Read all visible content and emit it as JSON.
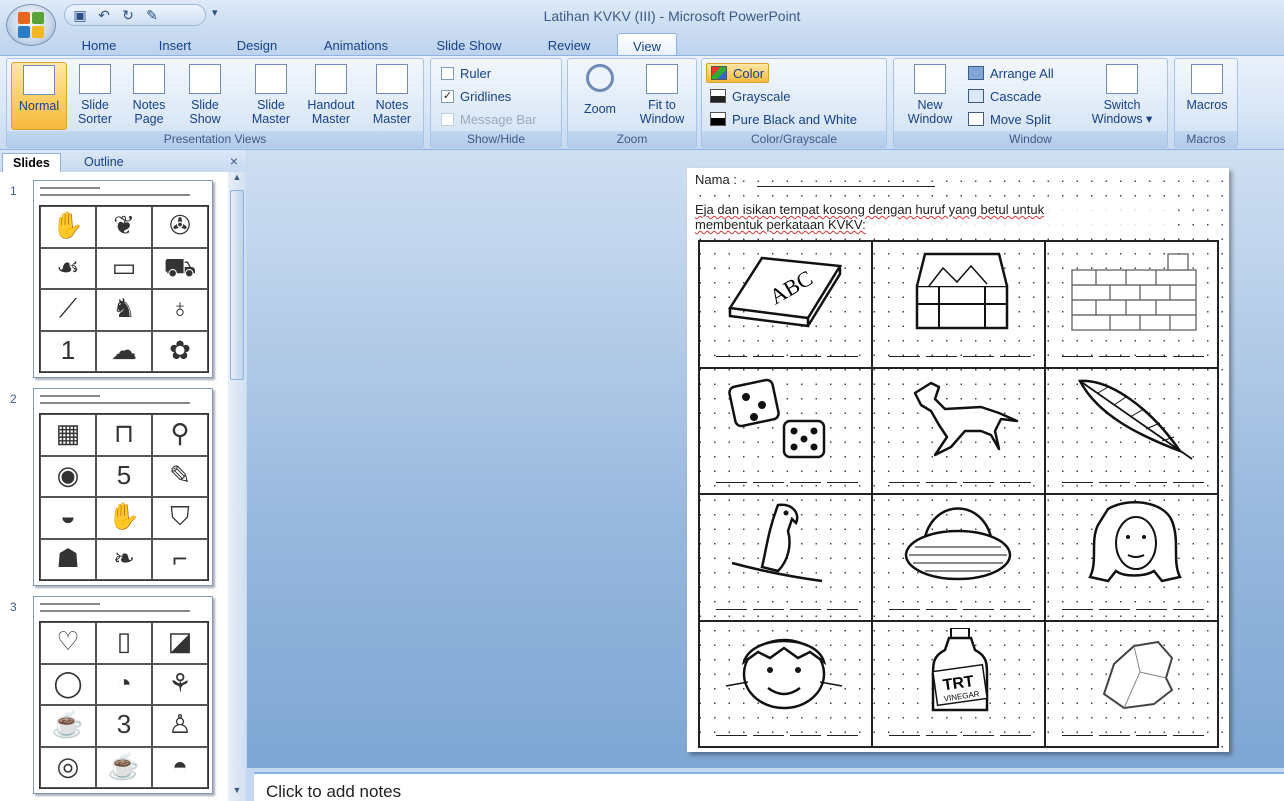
{
  "window": {
    "title": "Latihan KVKV (III) - Microsoft PowerPoint"
  },
  "qat": {
    "icons": [
      "save-icon",
      "undo-icon",
      "redo-icon",
      "repeat-icon"
    ],
    "more": "▾"
  },
  "tabs": [
    {
      "label": "Home"
    },
    {
      "label": "Insert"
    },
    {
      "label": "Design"
    },
    {
      "label": "Animations"
    },
    {
      "label": "Slide Show"
    },
    {
      "label": "Review"
    },
    {
      "label": "View"
    }
  ],
  "active_tab": "View",
  "ribbon": {
    "presentation_views": {
      "label": "Presentation Views",
      "buttons": [
        {
          "l1": "Normal",
          "l2": ""
        },
        {
          "l1": "Slide",
          "l2": "Sorter"
        },
        {
          "l1": "Notes",
          "l2": "Page"
        },
        {
          "l1": "Slide",
          "l2": "Show"
        },
        {
          "l1": "Slide",
          "l2": "Master"
        },
        {
          "l1": "Handout",
          "l2": "Master"
        },
        {
          "l1": "Notes",
          "l2": "Master"
        }
      ]
    },
    "show_hide": {
      "label": "Show/Hide",
      "items": [
        {
          "label": "Ruler",
          "checked": false
        },
        {
          "label": "Gridlines",
          "checked": true
        },
        {
          "label": "Message Bar",
          "checked": false
        }
      ]
    },
    "zoom": {
      "label": "Zoom",
      "zoom_btn": "Zoom",
      "fit_l1": "Fit to",
      "fit_l2": "Window"
    },
    "color_grayscale": {
      "label": "Color/Grayscale",
      "items": [
        {
          "label": "Color"
        },
        {
          "label": "Grayscale"
        },
        {
          "label": "Pure Black and White"
        }
      ]
    },
    "window": {
      "label": "Window",
      "new_l1": "New",
      "new_l2": "Window",
      "arrange_all": "Arrange All",
      "cascade": "Cascade",
      "move_split": "Move Split",
      "switch_l1": "Switch",
      "switch_l2": "Windows ▾"
    },
    "macros": {
      "label": "Macros",
      "button": "Macros"
    }
  },
  "left_pane": {
    "tabs": [
      {
        "label": "Slides"
      },
      {
        "label": "Outline"
      }
    ],
    "close": "×",
    "slides": [
      {
        "num": "1",
        "cells": [
          "",
          "",
          "",
          "",
          "",
          "",
          "",
          "",
          "",
          "1",
          "",
          ""
        ]
      },
      {
        "num": "2",
        "cells": [
          "",
          "",
          "",
          "",
          "5",
          "",
          "",
          "",
          "",
          "",
          "",
          ""
        ]
      },
      {
        "num": "3",
        "cells": [
          "",
          "",
          "",
          "",
          "",
          "",
          "",
          "3",
          "",
          "",
          "",
          ""
        ]
      }
    ]
  },
  "slide": {
    "nama_label": "Nama :",
    "instruction_part1": "Eja dan isikan tempat kosong dengan huruf yang betul untuk",
    "instruction_part2": "membentuk perkataan KVKV:",
    "cells": [
      {
        "picture": "buku"
      },
      {
        "picture": "peti"
      },
      {
        "picture": "batu-bata"
      },
      {
        "picture": "dadu"
      },
      {
        "picture": "kuda"
      },
      {
        "picture": "bulu"
      },
      {
        "picture": "burung-nuri"
      },
      {
        "picture": "bakul"
      },
      {
        "picture": "rambut"
      },
      {
        "picture": "muka"
      },
      {
        "picture": "cuka",
        "label": "TRT",
        "sublabel": "VINEGAR"
      },
      {
        "picture": "batu"
      }
    ]
  },
  "notes": {
    "placeholder": "Click to add notes"
  }
}
